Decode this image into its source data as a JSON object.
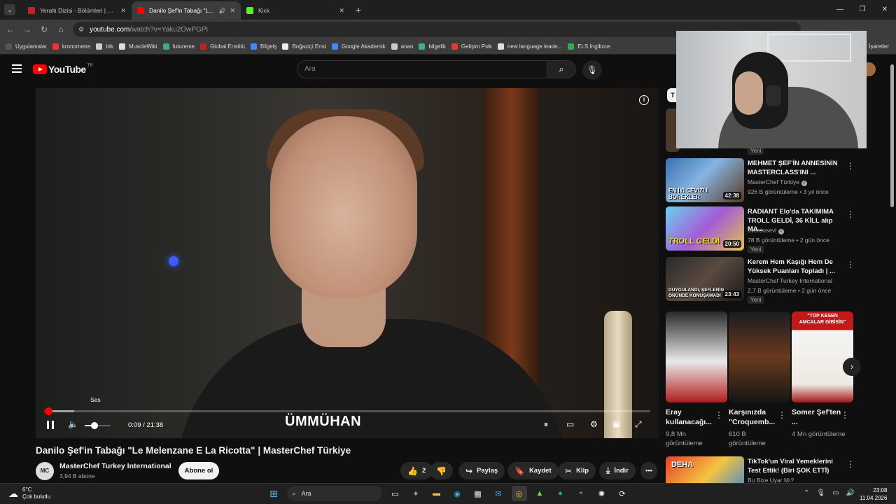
{
  "browser": {
    "tabs": [
      {
        "title": "Yeraltı Dizisi - Bölümleri | NOW",
        "fav_color": "#d11a2a",
        "active": false
      },
      {
        "title": "Danilo Şef'in Tabağı \"Le Me",
        "fav_color": "#ff0000",
        "active": true
      },
      {
        "title": "Kick",
        "fav_color": "#53fc18",
        "active": false
      }
    ],
    "url_domain": "youtube.com",
    "url_path": "/watch?v=Yaku2OwPGPI",
    "bookmarks": [
      "Uygulamalar",
      "kronometre",
      "btk",
      "MuscleWiki",
      "futureme",
      "Global Enstitü",
      "Bilgelş",
      "Boğaziçi Enst",
      "Google Akademik",
      "anan",
      "bilgelik",
      "Gelişim Psik",
      "new language leade...",
      "ELS İngilizce"
    ],
    "bookmarks_right": "İşaretler"
  },
  "youtube": {
    "logo_text": "YouTube",
    "country": "TR",
    "search_placeholder": "Ara",
    "player": {
      "caption_name": "ÜMMÜHAN",
      "tooltip": "Ses",
      "time": "0:09 / 21:38",
      "progress_fraction": 0.007,
      "buffered_fraction": 0.05,
      "volume_fraction": 0.4
    },
    "video_title": "Danilo Şef'in Tabağı \"Le Melenzane E La Ricotta\" | MasterChef Türkiye",
    "channel": {
      "name": "MasterChef Turkey International",
      "subs": "3,94 B abone",
      "subscribe": "Abone ol",
      "avatar": "MC"
    },
    "actions": {
      "likes": "2",
      "share": "Paylaş",
      "save": "Kaydet",
      "clip": "Klip",
      "download": "İndir"
    },
    "chip_letter": "T",
    "recommendations": [
      {
        "title": "MEHMET ŞEF'İN ANNESİNİN MASTERCLASS'INI ...",
        "channel": "MasterChef Türkiye",
        "verified": true,
        "meta": "926 B görüntüleme • 3 yıl önce",
        "duration": "42:38",
        "badge": "",
        "thumb_text": "EN İYİ CEVİZLİ BÖREKLER",
        "top_badge": "Yeni"
      },
      {
        "title": "RADIANT Elo'da TAKIMIMA TROLL GELDİ, 36 KİLL alıp MA...",
        "channel": "overdosevl",
        "verified": true,
        "meta": "78 B görüntüleme • 2 gün önce",
        "duration": "20:50",
        "badge": "Yeni",
        "thumb_text": "TROLL GELDİ"
      },
      {
        "title": "Kerem Hem Kaşığı Hem De Yüksek Puanları Topladı | ...",
        "channel": "MasterChef Turkey International",
        "verified": false,
        "meta": "2,7 B görüntüleme • 2 gün önce",
        "duration": "23:43",
        "badge": "Yeni",
        "thumb_text": "DUYGULANDI, ŞEFLERİN ÖNÜNDE KONUŞAMADI"
      }
    ],
    "shorts": [
      {
        "title": "Eray kullanacağı...",
        "views": "9,8 Mn görüntüleme"
      },
      {
        "title": "Karşınızda \"Croquemb...",
        "views": "610 B görüntüleme"
      },
      {
        "title": "Somer Şef'ten ...",
        "views": "4 Mn görüntüleme",
        "thumb_text": "\"TOP KESEN AMCALAR GİBİSİN\""
      }
    ],
    "bottom_rec": {
      "title": "TikTok'un Viral Yemeklerini Test Ettik! (Biri ŞOK ETTİ)",
      "channel": "Bu Bize Uyar Mı?",
      "thumb_text": "DEHA"
    }
  },
  "taskbar": {
    "temp": "6°C",
    "weather": "Çok bulutlu",
    "search": "Ara",
    "time": "23:08",
    "date": "11.04.2026"
  }
}
